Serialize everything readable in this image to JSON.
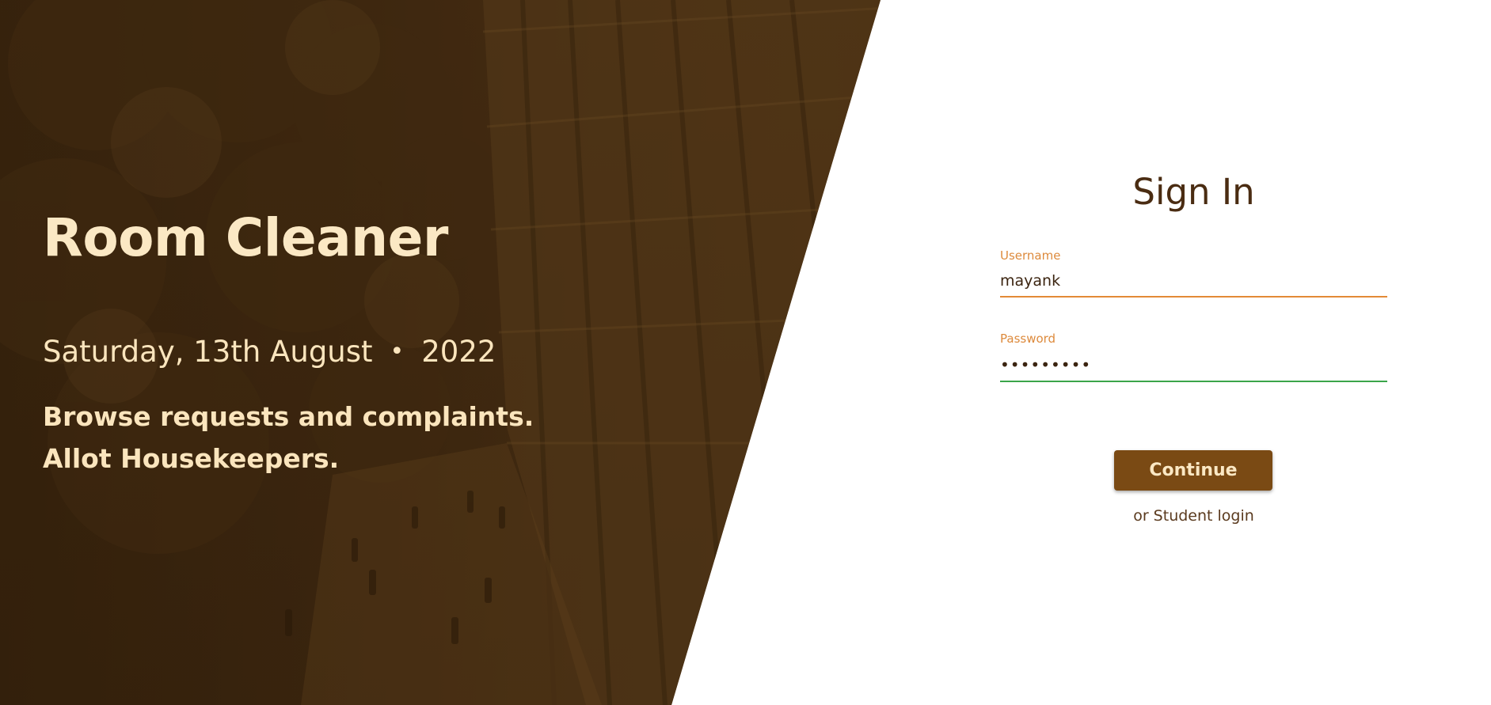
{
  "hero": {
    "app_title": "Room Cleaner",
    "date_day": "Saturday, 13th August",
    "date_separator": "•",
    "date_year": "2022",
    "tagline_line1": "Browse requests and complaints.",
    "tagline_line2": "Allot Housekeepers."
  },
  "signin": {
    "title": "Sign In",
    "username_label": "Username",
    "username_value": "mayank",
    "password_label": "Password",
    "password_value": "•••••••••",
    "continue_label": "Continue",
    "alt_login_label": "or Student login"
  },
  "colors": {
    "accent_orange": "#e38a36",
    "valid_green": "#3aa54a",
    "button_brown": "#7a4a14",
    "hero_text": "#fbe5bd"
  }
}
